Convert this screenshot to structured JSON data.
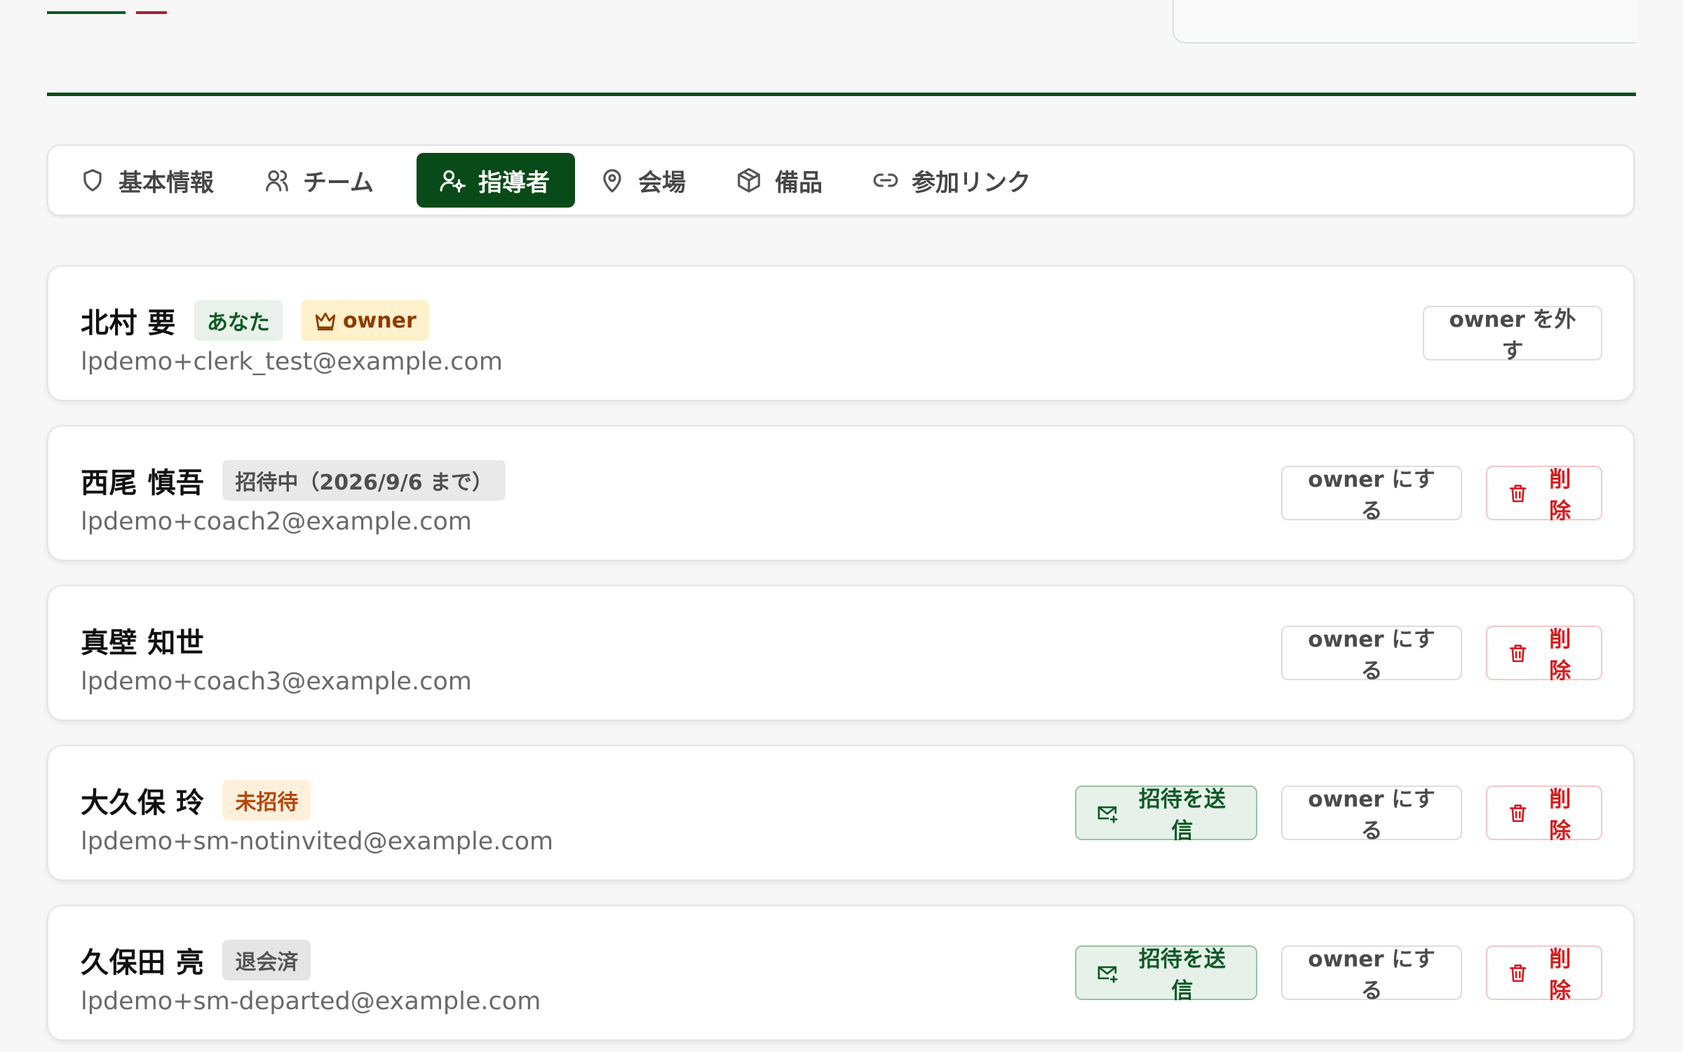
{
  "colors": {
    "primary": "#084a18",
    "background": "#f7f7f7",
    "danger": "#d51b1b"
  },
  "tabs": [
    {
      "label": "基本情報",
      "icon": "shield-icon",
      "active": false
    },
    {
      "label": "チーム",
      "icon": "users-icon",
      "active": false
    },
    {
      "label": "指導者",
      "icon": "user-settings-icon",
      "active": true
    },
    {
      "label": "会場",
      "icon": "map-pin-icon",
      "active": false
    },
    {
      "label": "備品",
      "icon": "package-icon",
      "active": false
    },
    {
      "label": "参加リンク",
      "icon": "link-icon",
      "active": false
    }
  ],
  "members": [
    {
      "name": "北村 要",
      "email": "lpdemo+clerk_test@example.com",
      "badges": [
        "あなた",
        "owner"
      ],
      "actions": [
        "owner を外す"
      ]
    },
    {
      "name": "西尾 慎吾",
      "email": "lpdemo+coach2@example.com",
      "badges": [
        "招待中（2026/9/6 まで）"
      ],
      "actions": [
        "owner にする",
        "削除"
      ]
    },
    {
      "name": "真壁 知世",
      "email": "lpdemo+coach3@example.com",
      "badges": [],
      "actions": [
        "owner にする",
        "削除"
      ]
    },
    {
      "name": "大久保 玲",
      "email": "lpdemo+sm-notinvited@example.com",
      "badges": [
        "未招待"
      ],
      "actions": [
        "招待を送信",
        "owner にする",
        "削除"
      ]
    },
    {
      "name": "久保田 亮",
      "email": "lpdemo+sm-departed@example.com",
      "badges": [
        "退会済"
      ],
      "actions": [
        "招待を送信",
        "owner にする",
        "削除"
      ]
    }
  ]
}
